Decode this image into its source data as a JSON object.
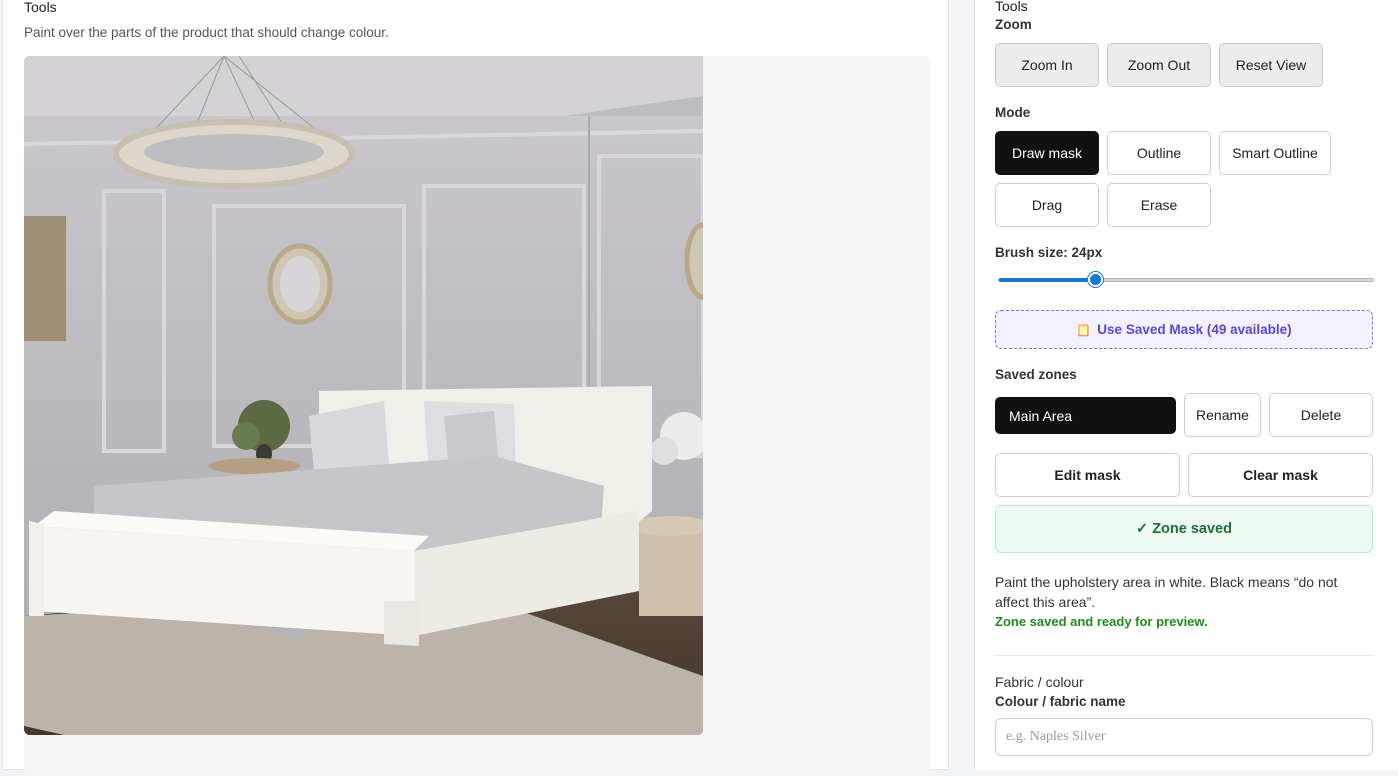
{
  "left": {
    "title": "Tools",
    "subtitle": "Paint over the parts of the product that should change colour."
  },
  "right": {
    "title": "Tools",
    "zoom": {
      "label": "Zoom",
      "buttons": [
        "Zoom In",
        "Zoom Out",
        "Reset View"
      ]
    },
    "mode": {
      "label": "Mode",
      "buttons": [
        "Draw mask",
        "Outline",
        "Smart Outline",
        "Drag",
        "Erase"
      ],
      "active": "Draw mask"
    },
    "brush": {
      "label": "Brush size: 24px",
      "value_fraction": 0.26
    },
    "saved_mask_button": "Use Saved Mask (49 available)",
    "saved_mask_icon": "clipboard-icon",
    "zones": {
      "label": "Saved zones",
      "selected": "Main Area",
      "rename": "Rename",
      "delete": "Delete"
    },
    "edit_mask": "Edit mask",
    "clear_mask": "Clear mask",
    "zone_saved_banner": "✓ Zone saved",
    "help_text": "Paint the upholstery area in white. Black means “do not affect this area”.",
    "ready_text": "Zone saved and ready for preview.",
    "fabric": {
      "section": "Fabric / colour",
      "label": "Colour / fabric name",
      "placeholder": "e.g. Naples Silver"
    }
  },
  "colors": {
    "accent": "#1677d4",
    "dark_button": "#111111",
    "saved_mask_text": "#5b46d6",
    "success": "#1c6e3a"
  }
}
